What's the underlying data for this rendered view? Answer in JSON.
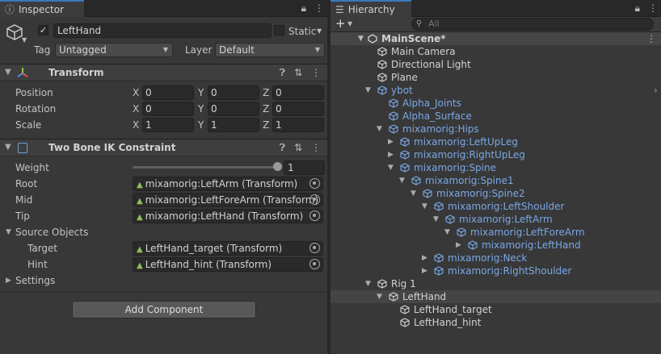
{
  "inspector": {
    "tab_label": "Inspector",
    "object_name": "LeftHand",
    "active_checked": true,
    "static_label": "Static",
    "tag_label": "Tag",
    "tag_value": "Untagged",
    "layer_label": "Layer",
    "layer_value": "Default",
    "transform": {
      "title": "Transform",
      "rows": [
        {
          "label": "Position",
          "x": "0",
          "y": "0",
          "z": "0"
        },
        {
          "label": "Rotation",
          "x": "0",
          "y": "0",
          "z": "0"
        },
        {
          "label": "Scale",
          "x": "1",
          "y": "1",
          "z": "1"
        }
      ],
      "axis_x": "X",
      "axis_y": "Y",
      "axis_z": "Z"
    },
    "ik": {
      "title": "Two Bone IK Constraint",
      "weight_label": "Weight",
      "weight_value": "1",
      "weight_fraction": 1,
      "root_label": "Root",
      "root_value": "mixamorig:LeftArm (Transform)",
      "mid_label": "Mid",
      "mid_value": "mixamorig:LeftForeArm (Transform)",
      "tip_label": "Tip",
      "tip_value": "mixamorig:LeftHand (Transform)",
      "source_label": "Source Objects",
      "target_label": "Target",
      "target_value": "LeftHand_target (Transform)",
      "hint_label": "Hint",
      "hint_value": "LeftHand_hint (Transform)",
      "settings_label": "Settings"
    },
    "add_component": "Add Component"
  },
  "hierarchy": {
    "tab_label": "Hierarchy",
    "search_placeholder": "All",
    "scene_name": "MainScene*",
    "items": [
      {
        "label": "Main Camera",
        "depth": 1,
        "prefab": false,
        "arrow": ""
      },
      {
        "label": "Directional Light",
        "depth": 1,
        "prefab": false,
        "arrow": ""
      },
      {
        "label": "Plane",
        "depth": 1,
        "prefab": false,
        "arrow": ""
      },
      {
        "label": "ybot",
        "depth": 1,
        "prefab": true,
        "arrow": "down"
      },
      {
        "label": "Alpha_Joints",
        "depth": 2,
        "prefab": true,
        "arrow": ""
      },
      {
        "label": "Alpha_Surface",
        "depth": 2,
        "prefab": true,
        "arrow": ""
      },
      {
        "label": "mixamorig:Hips",
        "depth": 2,
        "prefab": true,
        "arrow": "down"
      },
      {
        "label": "mixamorig:LeftUpLeg",
        "depth": 3,
        "prefab": true,
        "arrow": "right"
      },
      {
        "label": "mixamorig:RightUpLeg",
        "depth": 3,
        "prefab": true,
        "arrow": "right"
      },
      {
        "label": "mixamorig:Spine",
        "depth": 3,
        "prefab": true,
        "arrow": "down"
      },
      {
        "label": "mixamorig:Spine1",
        "depth": 4,
        "prefab": true,
        "arrow": "down"
      },
      {
        "label": "mixamorig:Spine2",
        "depth": 5,
        "prefab": true,
        "arrow": "down"
      },
      {
        "label": "mixamorig:LeftShoulder",
        "depth": 6,
        "prefab": true,
        "arrow": "down"
      },
      {
        "label": "mixamorig:LeftArm",
        "depth": 7,
        "prefab": true,
        "arrow": "down"
      },
      {
        "label": "mixamorig:LeftForeArm",
        "depth": 8,
        "prefab": true,
        "arrow": "down"
      },
      {
        "label": "mixamorig:LeftHand",
        "depth": 9,
        "prefab": true,
        "arrow": "right"
      },
      {
        "label": "mixamorig:Neck",
        "depth": 6,
        "prefab": true,
        "arrow": "right"
      },
      {
        "label": "mixamorig:RightShoulder",
        "depth": 6,
        "prefab": true,
        "arrow": "right"
      },
      {
        "label": "Rig 1",
        "depth": 1,
        "prefab": false,
        "arrow": "down",
        "rig": true
      },
      {
        "label": "LeftHand",
        "depth": 2,
        "prefab": false,
        "arrow": "down",
        "selected": true
      },
      {
        "label": "LeftHand_target",
        "depth": 3,
        "prefab": false,
        "arrow": ""
      },
      {
        "label": "LeftHand_hint",
        "depth": 3,
        "prefab": false,
        "arrow": ""
      }
    ]
  },
  "colors": {
    "accent": "#3a79bb",
    "prefab_text": "#7aa8e6",
    "panel_bg": "#383838"
  }
}
